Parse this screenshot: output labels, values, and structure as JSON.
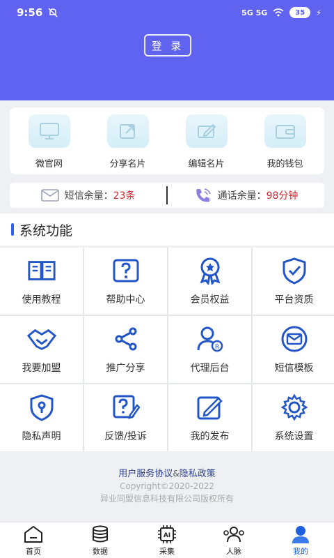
{
  "status_bar": {
    "time": "9:56",
    "signal": "5G 5G",
    "battery": "35"
  },
  "header": {
    "login_label": "登 录",
    "bg_color": "#6063ef"
  },
  "quick_actions": [
    {
      "label": "微官网",
      "icon": "monitor-icon"
    },
    {
      "label": "分享名片",
      "icon": "share-card-icon"
    },
    {
      "label": "编辑名片",
      "icon": "edit-card-icon"
    },
    {
      "label": "我的钱包",
      "icon": "wallet-icon"
    }
  ],
  "balance": {
    "sms_label": "短信余量：",
    "sms_value": "23条",
    "call_label": "通话余量：",
    "call_value": "98分钟",
    "value_color": "#d8262f"
  },
  "section": {
    "title": "系统功能"
  },
  "functions": [
    {
      "label": "使用教程",
      "icon": "book-icon"
    },
    {
      "label": "帮助中心",
      "icon": "help-icon"
    },
    {
      "label": "会员权益",
      "icon": "medal-icon"
    },
    {
      "label": "平台资质",
      "icon": "shield-check-icon"
    },
    {
      "label": "我要加盟",
      "icon": "handshake-icon"
    },
    {
      "label": "推广分享",
      "icon": "share-icon"
    },
    {
      "label": "代理后台",
      "icon": "agent-icon"
    },
    {
      "label": "短信模板",
      "icon": "mail-icon"
    },
    {
      "label": "隐私声明",
      "icon": "lock-shield-icon"
    },
    {
      "label": "反馈/投诉",
      "icon": "feedback-icon"
    },
    {
      "label": "我的发布",
      "icon": "publish-icon"
    },
    {
      "label": "系统设置",
      "icon": "gear-icon"
    }
  ],
  "footer": {
    "agreement": "用户服务协议",
    "amp": "&",
    "privacy": "隐私政策",
    "copyright": "Copyright©2020-2022",
    "company": "异业同盟信息科技有限公司版权所有"
  },
  "tabbar": [
    {
      "label": "首页",
      "icon": "home-icon"
    },
    {
      "label": "数据",
      "icon": "database-icon"
    },
    {
      "label": "采集",
      "icon": "ai-chip-icon"
    },
    {
      "label": "人脉",
      "icon": "contacts-icon"
    },
    {
      "label": "我的",
      "icon": "profile-icon",
      "active": true
    }
  ],
  "accent_color": "#2f62e8"
}
